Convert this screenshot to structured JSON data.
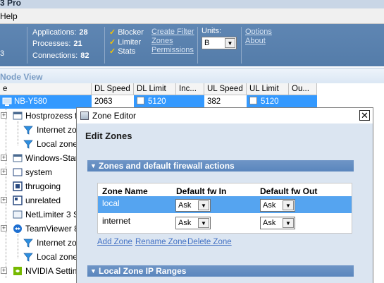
{
  "app": {
    "title_fragment": "3 Pro"
  },
  "menubar": {
    "visible_item": "Help"
  },
  "stats": {
    "left_value": "3",
    "applications_label": "Applications:",
    "applications_value": "28",
    "processes_label": "Processes:",
    "processes_value": "21",
    "connections_label": "Connections:",
    "connections_value": "82",
    "toggles": [
      "Blocker",
      "Limiter",
      "Stats"
    ],
    "links": [
      "Create Filter",
      "Zones",
      "Permissions"
    ],
    "units_label": "Units:",
    "units_value": "B",
    "right_links": [
      "Options",
      "About"
    ]
  },
  "node_view": {
    "title": "Node View",
    "columns": [
      "e",
      "DL Speed",
      "DL Limit",
      "Inc...",
      "UL Speed",
      "UL Limit",
      "Ou..."
    ],
    "selected_row": {
      "name": "NB-Y580",
      "dl_speed": "2063",
      "dl_limit": "5120",
      "ul_speed": "382",
      "ul_limit": "5120"
    },
    "tree": [
      {
        "label": "Hostprozess fi",
        "icon": "app-window-icon",
        "expandable": true
      },
      {
        "label": "Internet zo",
        "icon": "filter-funnel-icon",
        "expandable": false
      },
      {
        "label": "Local zone",
        "icon": "filter-funnel-icon",
        "expandable": false
      },
      {
        "label": "Windows-Star",
        "icon": "app-window-icon",
        "expandable": true
      },
      {
        "label": "system",
        "icon": "system-window-icon",
        "expandable": true
      },
      {
        "label": "thrugoing",
        "icon": "thrugoing-icon",
        "expandable": false
      },
      {
        "label": "unrelated",
        "icon": "unrelated-icon",
        "expandable": true
      },
      {
        "label": "NetLimiter 3 S",
        "icon": "app-window-icon",
        "expandable": false
      },
      {
        "label": "TeamViewer 8",
        "icon": "teamviewer-icon",
        "expandable": true
      },
      {
        "label": "Internet zo",
        "icon": "filter-funnel-icon",
        "expandable": false
      },
      {
        "label": "Local zone",
        "icon": "filter-funnel-icon",
        "expandable": false
      },
      {
        "label": "NVIDIA Settin",
        "icon": "nvidia-icon",
        "expandable": true
      }
    ]
  },
  "dialog": {
    "title": "Zone Editor",
    "close_glyph": "✕",
    "heading": "Edit Zones",
    "section1": "Zones and default firewall actions",
    "table": {
      "headers": [
        "Zone Name",
        "Default fw In",
        "Default fw Out"
      ],
      "rows": [
        {
          "name": "local",
          "fw_in": "Ask",
          "fw_out": "Ask",
          "selected": true
        },
        {
          "name": "internet",
          "fw_in": "Ask",
          "fw_out": "Ask",
          "selected": false
        }
      ]
    },
    "links": [
      "Add Zone",
      "Rename Zone",
      "Delete Zone"
    ],
    "section2": "Local Zone IP Ranges"
  },
  "colors": {
    "panel_blue": "#5a82b0",
    "selection_blue": "#3399ff",
    "section_blue": "#6690c4",
    "dialog_bg": "#dbe5f1",
    "link_blue": "#4472c4",
    "check_yellow": "#f5c400"
  }
}
